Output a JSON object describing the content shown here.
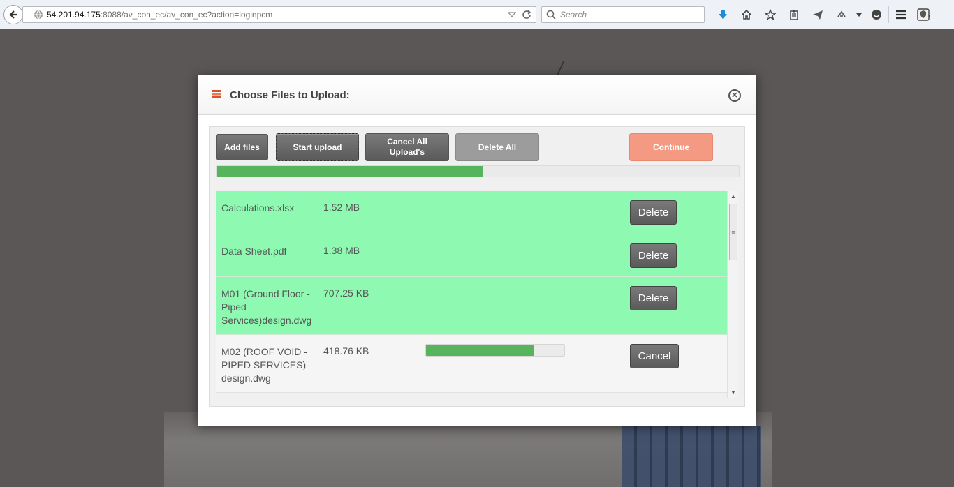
{
  "browser": {
    "url_host": "54.201.94.175",
    "url_rest": ":8088/av_con_ec/av_con_ec?action=loginpcm",
    "search_placeholder": "Search"
  },
  "modal": {
    "title": "Choose Files to Upload:",
    "close_label": "✕",
    "buttons": {
      "add_files": "Add files",
      "start_upload": "Start upload",
      "cancel_all": "Cancel All Upload's",
      "delete_all": "Delete All",
      "continue": "Continue"
    },
    "overall_progress": 0.51,
    "files": [
      {
        "name": "Calculations.xlsx",
        "size": "1.52 MB",
        "action": "Delete",
        "status": "done"
      },
      {
        "name": "Data Sheet.pdf",
        "size": "1.38 MB",
        "action": "Delete",
        "status": "done"
      },
      {
        "name": "M01 (Ground Floor - Piped Services)design.dwg",
        "size": "707.25 KB",
        "action": "Delete",
        "status": "done"
      },
      {
        "name": "M02 (ROOF VOID - PIPED SERVICES) design.dwg",
        "size": "418.76 KB",
        "action": "Cancel",
        "status": "uploading",
        "progress": 0.78
      }
    ]
  },
  "colors": {
    "done_row": "#8ef9b0",
    "progress": "#56b45c",
    "continue_button": "#f49a82",
    "title_icon": "#d9532c"
  }
}
